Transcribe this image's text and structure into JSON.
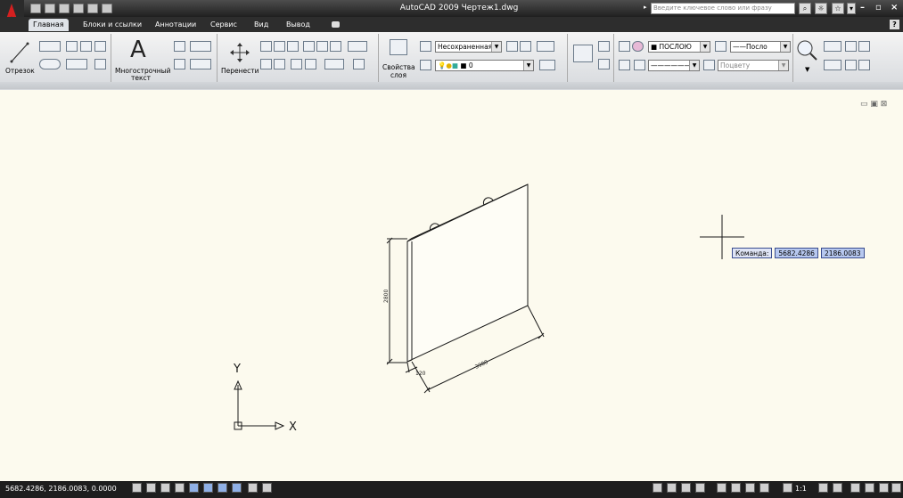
{
  "window": {
    "title": "AutoCAD 2009 Чертеж1.dwg",
    "search_placeholder": "Введите ключевое слово или фразу",
    "help": "?"
  },
  "tabs": [
    {
      "label": "Главная",
      "active": true
    },
    {
      "label": "Блоки и ссылки"
    },
    {
      "label": "Аннотации"
    },
    {
      "label": "Сервис"
    },
    {
      "label": "Вид"
    },
    {
      "label": "Вывод"
    }
  ],
  "ribbon": {
    "draw": {
      "line_label": "Отрезок"
    },
    "annotation": {
      "mtext_label_1": "Многострочный",
      "mtext_label_2": "текст"
    },
    "modify": {
      "move_label": "Перенести"
    },
    "layers": {
      "props_label_1": "Свойства",
      "props_label_2": "слоя",
      "layer_state": "Несохраненная",
      "current_layer": "0"
    },
    "properties": {
      "color": "ПОСЛОЮ",
      "lineweight": "Посло",
      "plot_style": "Поцвету"
    }
  },
  "viewport": {
    "command_label": "Команда:",
    "cursor_x": "5682.4286",
    "cursor_y": "2186.0083",
    "dim_height": "2800",
    "dim_thickness": "120",
    "dim_length": "3980",
    "ucs_x": "X",
    "ucs_y": "Y",
    "controls": "▭ ▣ ⊠"
  },
  "status": {
    "coordinates": "5682.4286, 2186.0083, 0.0000",
    "scale": "1:1"
  },
  "colors": {
    "titlebar": "#2d2d2d",
    "background": "#fcfaee",
    "tooltip_border": "#3a4d8f"
  }
}
